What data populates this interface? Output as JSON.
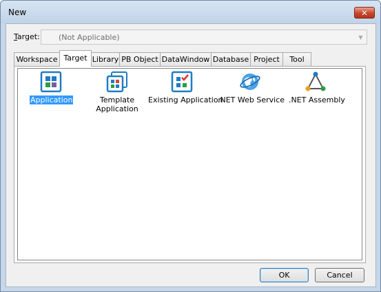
{
  "window": {
    "title": "New"
  },
  "target": {
    "label_prefix": "",
    "label_underlined": "T",
    "label_rest": "arget:",
    "value": "(Not Applicable)"
  },
  "tabs": [
    {
      "label": "Workspace",
      "active": false
    },
    {
      "label": "Target",
      "active": true
    },
    {
      "label": "Library",
      "active": false
    },
    {
      "label": "PB Object",
      "active": false
    },
    {
      "label": "DataWindow",
      "active": false
    },
    {
      "label": "Database",
      "active": false
    },
    {
      "label": "Project",
      "active": false
    },
    {
      "label": "Tool",
      "active": false
    }
  ],
  "items": [
    {
      "label": "Application",
      "icon": "application-icon",
      "selected": true
    },
    {
      "label_line1": "Template",
      "label_line2": "Application",
      "icon": "template-application-icon",
      "selected": false
    },
    {
      "label": "Existing Application",
      "icon": "existing-application-icon",
      "selected": false
    },
    {
      "label": ".NET Web Service",
      "icon": "net-web-service-icon",
      "selected": false
    },
    {
      "label": ".NET Assembly",
      "icon": "net-assembly-icon",
      "selected": false
    }
  ],
  "buttons": {
    "ok": "OK",
    "cancel": "Cancel"
  },
  "colors": {
    "accent": "#3399ff",
    "icon_blue": "#1f7bc4",
    "close_red": "#c7462b"
  }
}
